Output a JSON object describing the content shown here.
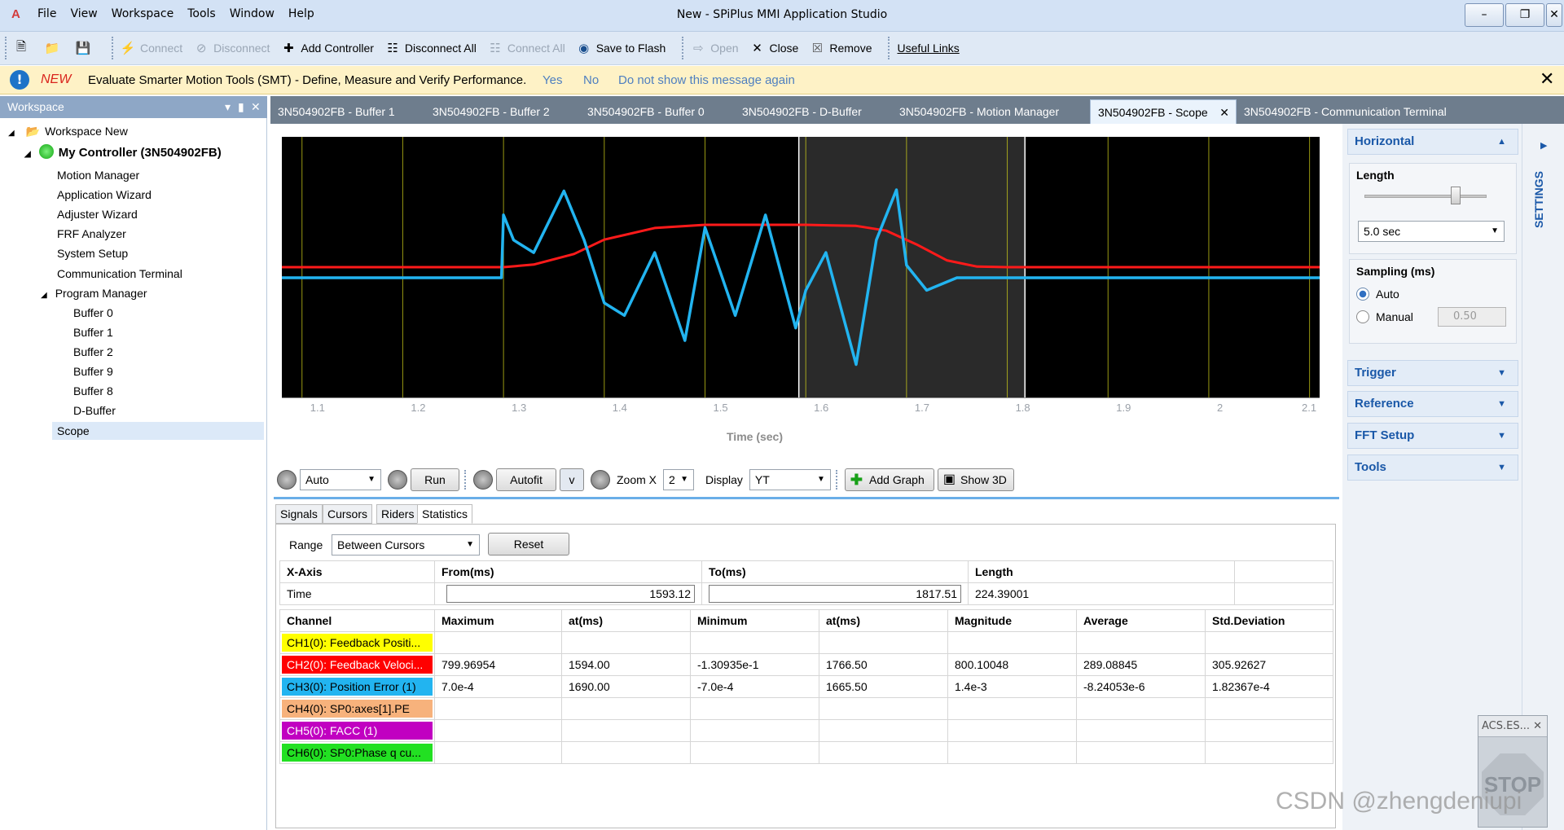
{
  "app": {
    "title": "New - SPiPlus MMI Application Studio",
    "logo": "A"
  },
  "menu": [
    "File",
    "View",
    "Workspace",
    "Tools",
    "Window",
    "Help"
  ],
  "toolbar": {
    "connect": "Connect",
    "disconnect": "Disconnect",
    "add_controller": "Add Controller",
    "disconnect_all": "Disconnect All",
    "connect_all": "Connect All",
    "save_to_flash": "Save to Flash",
    "open": "Open",
    "close": "Close",
    "remove": "Remove",
    "useful_links": "Useful Links"
  },
  "message": {
    "badge": "NEW",
    "text": "Evaluate Smarter Motion Tools (SMT) - Define, Measure and Verify Performance.",
    "yes": "Yes",
    "no": "No",
    "dont_show": "Do not show this message again"
  },
  "workspace": {
    "title": "Workspace",
    "root": "Workspace New",
    "controller": "My Controller (3N504902FB)",
    "items": [
      "Motion Manager",
      "Application Wizard",
      "Adjuster Wizard",
      "FRF Analyzer",
      "System Setup",
      "Communication Terminal",
      "Program Manager"
    ],
    "buffers": [
      "Buffer 0",
      "Buffer 1",
      "Buffer 2",
      "Buffer 9",
      "Buffer 8",
      "D-Buffer"
    ],
    "selected": "Scope"
  },
  "tabs": [
    "3N504902FB - Buffer 1",
    "3N504902FB - Buffer 2",
    "3N504902FB - Buffer 0",
    "3N504902FB - D-Buffer",
    "3N504902FB - Motion Manager",
    "3N504902FB - Scope",
    "3N504902FB - Communication Terminal"
  ],
  "active_tab_index": 5,
  "scope": {
    "x_ticks": [
      "1.1",
      "1.2",
      "1.3",
      "1.4",
      "1.5",
      "1.6",
      "1.7",
      "1.8",
      "1.9",
      "2",
      "2.1"
    ],
    "x_label": "Time (sec)",
    "controls": {
      "mode": "Auto",
      "run": "Run",
      "autofit": "Autofit",
      "v": "v",
      "zoom_label": "Zoom X",
      "zoom_value": "2",
      "display_label": "Display",
      "display_value": "YT",
      "add_graph": "Add Graph",
      "show_3d": "Show 3D"
    },
    "colors": {
      "feedback_velocity": "#ff1a1a",
      "position_error": "#22b4f0",
      "gridline": "#d9d91a",
      "cursor": "#ffffff"
    }
  },
  "chart_data": {
    "type": "line",
    "title": "",
    "xlabel": "Time (sec)",
    "ylabel": "",
    "xlim": [
      1.08,
      2.11
    ],
    "grid": true,
    "cursors": [
      1.59312,
      1.81751
    ],
    "series": [
      {
        "name": "CH2(0): Feedback Veloci...",
        "x": [
          1.08,
          1.3,
          1.33,
          1.37,
          1.4,
          1.45,
          1.5,
          1.55,
          1.6,
          1.65,
          1.68,
          1.71,
          1.74,
          1.77,
          1.8,
          2.11
        ],
        "values": [
          0,
          0,
          50,
          250,
          520,
          740,
          800,
          800,
          800,
          780,
          690,
          430,
          130,
          10,
          0,
          0
        ]
      },
      {
        "name": "CH3(0): Position Error (1)",
        "x": [
          1.08,
          1.298,
          1.3,
          1.31,
          1.33,
          1.36,
          1.38,
          1.4,
          1.42,
          1.45,
          1.48,
          1.5,
          1.53,
          1.56,
          1.59,
          1.6,
          1.62,
          1.65,
          1.67,
          1.69,
          1.7,
          1.72,
          1.75,
          1.8,
          2.11
        ],
        "values": [
          0,
          0,
          0.0005,
          0.0003,
          0.0002,
          0.00069,
          0.0003,
          -0.0002,
          -0.0003,
          0.0002,
          -0.0005,
          0.0004,
          -0.0003,
          0.0005,
          -0.0004,
          -0.0001,
          0.0002,
          -0.00069,
          0.0003,
          0.0007,
          0.0001,
          -0.0001,
          0.0,
          0.0,
          0
        ]
      }
    ]
  },
  "stats": {
    "tabs": [
      "Signals",
      "Cursors",
      "Riders",
      "Statistics"
    ],
    "active": "Statistics",
    "range_label": "Range",
    "range_value": "Between Cursors",
    "reset": "Reset",
    "xaxis_headers": [
      "X-Axis",
      "From(ms)",
      "To(ms)",
      "Length"
    ],
    "xaxis_row": [
      "Time",
      "1593.12",
      "1817.51",
      "224.39001"
    ],
    "headers": [
      "Channel",
      "Maximum",
      "at(ms)",
      "Minimum",
      "at(ms)",
      "Magnitude",
      "Average",
      "Std.Deviation"
    ],
    "rows": [
      {
        "channel": "CH1(0): Feedback Positi...",
        "color": "#ffff00",
        "text_color": "#000000",
        "cells": [
          "",
          "",
          "",
          "",
          "",
          "",
          ""
        ]
      },
      {
        "channel": "CH2(0): Feedback Veloci...",
        "color": "#ff0000",
        "text_color": "#ffffff",
        "cells": [
          "799.96954",
          "1594.00",
          "-1.30935e-1",
          "1766.50",
          "800.10048",
          "289.08845",
          "305.92627"
        ]
      },
      {
        "channel": "CH3(0): Position Error (1)",
        "color": "#22b4f0",
        "text_color": "#000000",
        "cells": [
          "7.0e-4",
          "1690.00",
          "-7.0e-4",
          "1665.50",
          "1.4e-3",
          "-8.24053e-6",
          "1.82367e-4"
        ]
      },
      {
        "channel": "CH4(0): SP0:axes[1].PE",
        "color": "#f7b27c",
        "text_color": "#000000",
        "cells": [
          "",
          "",
          "",
          "",
          "",
          "",
          ""
        ]
      },
      {
        "channel": "CH5(0): FACC (1)",
        "color": "#c100c1",
        "text_color": "#ffffff",
        "cells": [
          "",
          "",
          "",
          "",
          "",
          "",
          ""
        ]
      },
      {
        "channel": "CH6(0): SP0:Phase q cu...",
        "color": "#22e022",
        "text_color": "#000000",
        "cells": [
          "",
          "",
          "",
          "",
          "",
          "",
          ""
        ]
      }
    ]
  },
  "right": {
    "horizontal": "Horizontal",
    "length_label": "Length",
    "length_value": "5.0 sec",
    "sampling_label": "Sampling (ms)",
    "auto": "Auto",
    "manual": "Manual",
    "manual_value": "0.50",
    "trigger": "Trigger",
    "reference": "Reference",
    "fft": "FFT Setup",
    "tools": "Tools",
    "settings": "SETTINGS"
  },
  "stop_widget": {
    "title": "ACS.ES...",
    "stop": "STOP"
  },
  "watermark": "CSDN @zhengdeniupi"
}
